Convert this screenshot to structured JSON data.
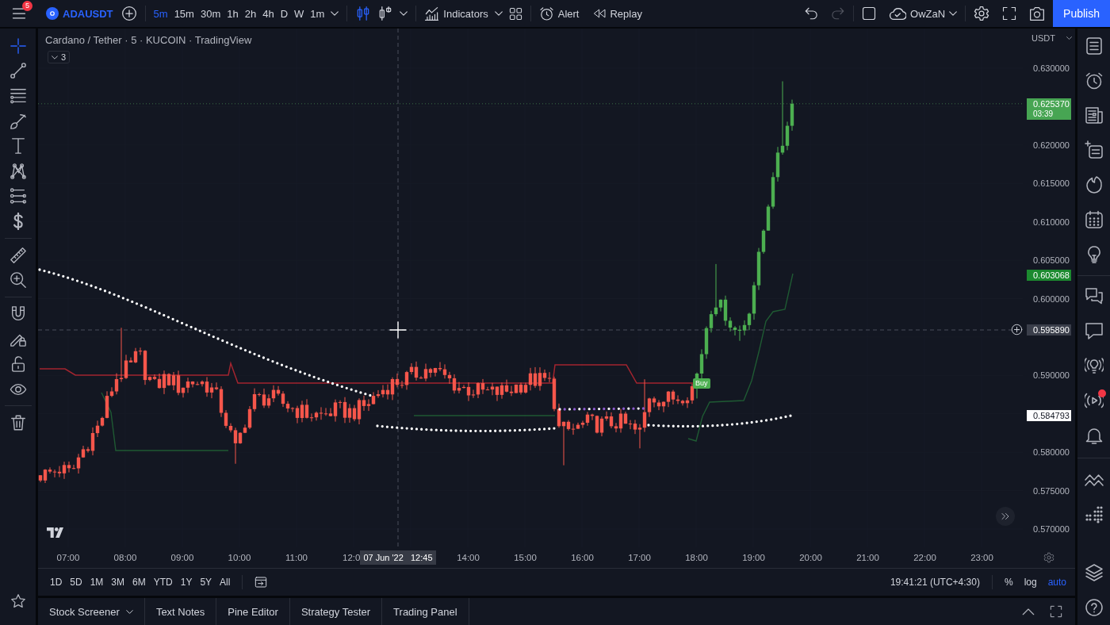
{
  "top_bar": {
    "menu_badge": "5",
    "symbol": "ADAUSDT",
    "intervals": [
      {
        "label": "5m",
        "selected": true
      },
      {
        "label": "15m",
        "selected": false
      },
      {
        "label": "30m",
        "selected": false
      },
      {
        "label": "1h",
        "selected": false
      },
      {
        "label": "2h",
        "selected": false
      },
      {
        "label": "4h",
        "selected": false
      },
      {
        "label": "D",
        "selected": false
      },
      {
        "label": "W",
        "selected": false
      },
      {
        "label": "1m",
        "selected": false
      }
    ],
    "chart_styles": [
      {
        "selected": true
      },
      {
        "selected": false
      }
    ],
    "indicators_label": "Indicators",
    "alert_label": "Alert",
    "replay_label": "Replay",
    "undo": {
      "disabled": false
    },
    "redo": {
      "disabled": true
    },
    "layout_name": "OwZaN",
    "publish_label": "Publish"
  },
  "left_toolbar": {
    "tools": [
      {
        "selected": true
      },
      {
        "selected": false
      },
      {
        "selected": false
      },
      {
        "selected": false
      },
      {
        "selected": false
      },
      {
        "selected": false
      },
      {
        "selected": false
      },
      {
        "selected": false
      },
      {
        "selected": false
      },
      {
        "selected": false
      },
      {
        "selected": false
      },
      {
        "selected": false
      },
      {
        "selected": false
      },
      {
        "selected": false
      },
      {
        "selected": false
      }
    ]
  },
  "chart": {
    "legend": "Cardano / Tether · 5 · KUCOIN · TradingView",
    "legend_count": "3",
    "signal_label": "Buy",
    "price_scale": {
      "currency": "USDT",
      "labels": [
        {
          "kind": "tick",
          "text": "0.630000"
        },
        {
          "kind": "last",
          "text": "0.625370",
          "countdown": "03:39"
        },
        {
          "kind": "tick",
          "text": "0.620000"
        },
        {
          "kind": "tick",
          "text": "0.615000"
        },
        {
          "kind": "tick",
          "text": "0.610000"
        },
        {
          "kind": "tick",
          "text": "0.605000"
        },
        {
          "kind": "level",
          "text": "0.603068"
        },
        {
          "kind": "tick",
          "text": "0.600000"
        },
        {
          "kind": "crosshair",
          "text": "0.595890"
        },
        {
          "kind": "tick",
          "text": "0.590000"
        },
        {
          "kind": "indicator",
          "text": "0.584793"
        },
        {
          "kind": "tick",
          "text": "0.580000"
        },
        {
          "kind": "tick",
          "text": "0.575000"
        },
        {
          "kind": "tick",
          "text": "0.570000"
        }
      ]
    },
    "time_scale": {
      "labels": [
        {
          "kind": "tick",
          "text": "07:00"
        },
        {
          "kind": "tick",
          "text": "08:00"
        },
        {
          "kind": "tick",
          "text": "09:00"
        },
        {
          "kind": "tick",
          "text": "10:00"
        },
        {
          "kind": "tick",
          "text": "11:00"
        },
        {
          "kind": "cut",
          "text": "12:0"
        },
        {
          "kind": "crosshair",
          "text": "07 Jun '22   12:45"
        },
        {
          "kind": "tick",
          "text": "14:00"
        },
        {
          "kind": "tick",
          "text": "15:00"
        },
        {
          "kind": "tick",
          "text": "16:00"
        },
        {
          "kind": "tick",
          "text": "17:00"
        },
        {
          "kind": "tick",
          "text": "18:00"
        },
        {
          "kind": "tick",
          "text": "19:00"
        },
        {
          "kind": "tick",
          "text": "20:00"
        },
        {
          "kind": "tick",
          "text": "21:00"
        },
        {
          "kind": "tick",
          "text": "22:00"
        },
        {
          "kind": "tick",
          "text": "23:00"
        }
      ]
    }
  },
  "range_bar": {
    "ranges": [
      {
        "label": "1D",
        "selected": false
      },
      {
        "label": "5D",
        "selected": false
      },
      {
        "label": "1M",
        "selected": false
      },
      {
        "label": "3M",
        "selected": false
      },
      {
        "label": "6M",
        "selected": false
      },
      {
        "label": "YTD",
        "selected": false
      },
      {
        "label": "1Y",
        "selected": false
      },
      {
        "label": "5Y",
        "selected": false
      },
      {
        "label": "All",
        "selected": false
      }
    ],
    "clock": "19:41:21 (UTC+4:30)",
    "scale_modes": [
      {
        "label": "%",
        "selected": false
      },
      {
        "label": "log",
        "selected": false
      },
      {
        "label": "auto",
        "selected": true
      }
    ]
  },
  "bottom_panel": {
    "tabs": [
      {
        "kind": "dropdown",
        "label": "Stock Screener",
        "selected": false
      },
      {
        "kind": "tab",
        "label": "Text Notes",
        "selected": false
      },
      {
        "kind": "tab",
        "label": "Pine Editor",
        "selected": false
      },
      {
        "kind": "tab",
        "label": "Strategy Tester",
        "selected": false
      },
      {
        "kind": "tab",
        "label": "Trading Panel",
        "selected": false
      }
    ]
  },
  "right_sidebar": {
    "buttons": [
      {
        "notification": false
      },
      {
        "notification": false
      },
      {
        "notification": false
      },
      {
        "notification": false
      },
      {
        "notification": false
      },
      {
        "notification": false
      },
      {
        "notification": false
      },
      {
        "notification": false
      },
      {
        "notification": false
      },
      {
        "notification": false
      },
      {
        "notification": true
      },
      {
        "notification": false
      },
      {
        "notification": false
      },
      {
        "notification": false
      },
      {
        "notification": false
      },
      {
        "notification": false
      }
    ]
  }
}
